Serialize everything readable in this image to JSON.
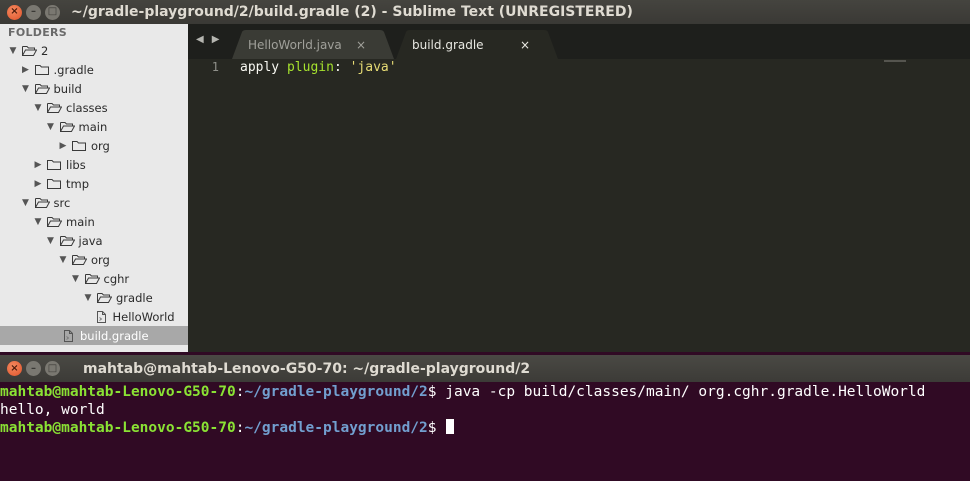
{
  "sublime": {
    "title": "~/gradle-playground/2/build.gradle (2) - Sublime Text (UNREGISTERED)",
    "sidebar": {
      "header": "FOLDERS",
      "items": [
        {
          "label": "2",
          "type": "folder",
          "expanded": true,
          "depth": 0
        },
        {
          "label": ".gradle",
          "type": "folder",
          "expanded": false,
          "depth": 1
        },
        {
          "label": "build",
          "type": "folder",
          "expanded": true,
          "depth": 1
        },
        {
          "label": "classes",
          "type": "folder",
          "expanded": true,
          "depth": 2
        },
        {
          "label": "main",
          "type": "folder",
          "expanded": true,
          "depth": 3
        },
        {
          "label": "org",
          "type": "folder",
          "expanded": false,
          "depth": 4
        },
        {
          "label": "libs",
          "type": "folder",
          "expanded": false,
          "depth": 2
        },
        {
          "label": "tmp",
          "type": "folder",
          "expanded": false,
          "depth": 2
        },
        {
          "label": "src",
          "type": "folder",
          "expanded": true,
          "depth": 1
        },
        {
          "label": "main",
          "type": "folder",
          "expanded": true,
          "depth": 2
        },
        {
          "label": "java",
          "type": "folder",
          "expanded": true,
          "depth": 3
        },
        {
          "label": "org",
          "type": "folder",
          "expanded": true,
          "depth": 4
        },
        {
          "label": "cghr",
          "type": "folder",
          "expanded": true,
          "depth": 5
        },
        {
          "label": "gradle",
          "type": "folder",
          "expanded": true,
          "depth": 6
        },
        {
          "label": "HelloWorld",
          "type": "file",
          "depth": 7
        },
        {
          "label": "build.gradle",
          "type": "file",
          "depth": 2,
          "selected": true
        }
      ]
    },
    "tabs": [
      {
        "label": "HelloWorld.java",
        "close": "×",
        "active": false
      },
      {
        "label": "build.gradle",
        "close": "×",
        "active": true
      }
    ],
    "nav": {
      "back": "◀",
      "forward": "▶"
    },
    "editor": {
      "line_number": "1",
      "code": {
        "word1": "apply ",
        "word2": "plugin",
        "word3": ": ",
        "word4": "'java'"
      }
    }
  },
  "terminal": {
    "title": "mahtab@mahtab-Lenovo-G50-70: ~/gradle-playground/2",
    "lines": [
      {
        "user": "mahtab@mahtab-Lenovo-G50-70",
        "sep": ":",
        "path": "~/gradle-playground/2",
        "prompt": "$ ",
        "cmd": "java -cp build/classes/main/ org.cghr.gradle.HelloWorld"
      },
      {
        "output": "hello, world"
      },
      {
        "user": "mahtab@mahtab-Lenovo-G50-70",
        "sep": ":",
        "path": "~/gradle-playground/2",
        "prompt": "$ ",
        "cmd": ""
      }
    ]
  },
  "window_buttons": {
    "close": "×",
    "minimize": "–",
    "maximize": "□"
  }
}
